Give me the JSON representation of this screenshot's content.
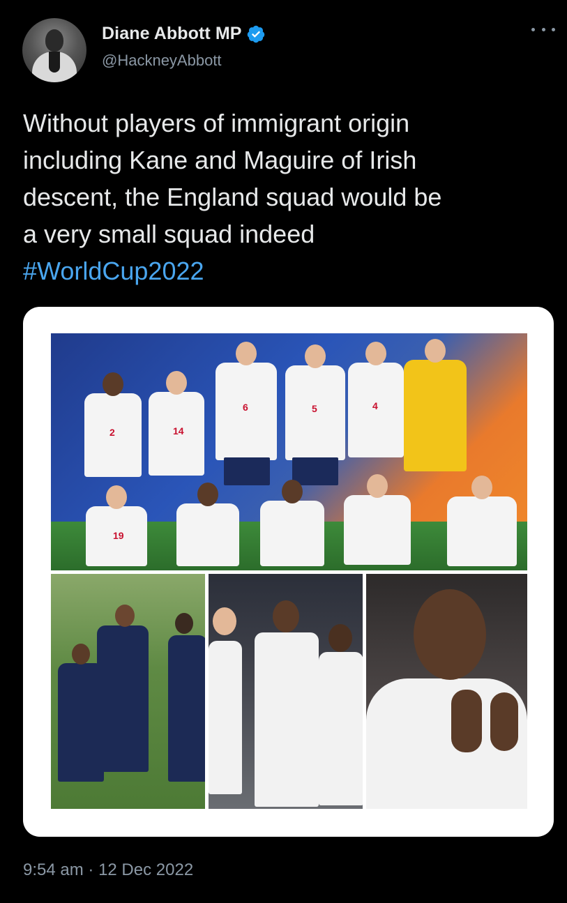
{
  "tweet": {
    "display_name": "Diane Abbott MP",
    "handle": "@HackneyAbbott",
    "verified": true,
    "text": "Without players of immigrant origin\nincluding Kane and Maguire of Irish\ndescent, the England squad would be\na very small squad indeed",
    "hashtag": "#WorldCup2022",
    "time": "9:54 am",
    "separator": "·",
    "date": "12 Dec 2022"
  },
  "colors": {
    "background": "#000000",
    "primary_text": "#e7e9ea",
    "secondary_text": "#8b98a5",
    "link": "#4aa6ef",
    "verified_badge": "#1d9bf0"
  },
  "icons": {
    "verified": "verified-badge-icon",
    "more": "more-options-icon"
  }
}
